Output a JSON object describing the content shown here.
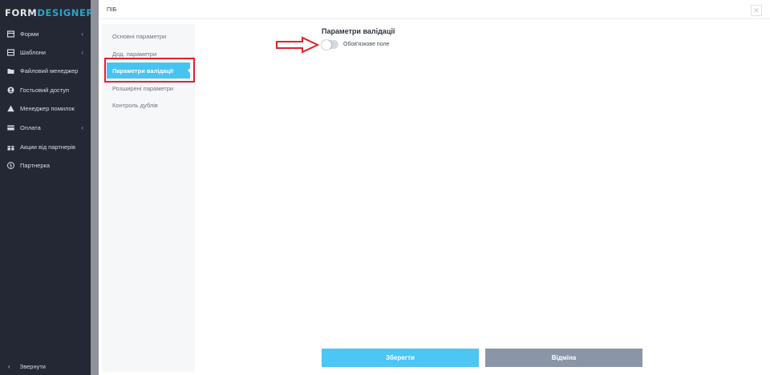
{
  "sidebar": {
    "logo_part1": "FORM",
    "logo_part2": "DESIGNER",
    "items": [
      {
        "label": "Форми",
        "icon": "forms-icon",
        "has_chevron": true
      },
      {
        "label": "Шаблони",
        "icon": "templates-icon",
        "has_chevron": true
      },
      {
        "label": "Файловий менеджер",
        "icon": "folder-icon",
        "has_chevron": false
      },
      {
        "label": "Гостьовий доступ",
        "icon": "user-circle-icon",
        "has_chevron": false
      },
      {
        "label": "Менеджер помилок",
        "icon": "warning-icon",
        "has_chevron": false
      },
      {
        "label": "Оплата",
        "icon": "credit-card-icon",
        "has_chevron": true
      },
      {
        "label": "Акции від партнерів",
        "icon": "gift-icon",
        "has_chevron": false
      },
      {
        "label": "Партнерка",
        "icon": "dollar-icon",
        "has_chevron": false
      }
    ],
    "collapse_label": "Звернути"
  },
  "modal": {
    "title": "ПІБ",
    "tabs": [
      {
        "label": "Основні параметри"
      },
      {
        "label": "Дод. параметри"
      },
      {
        "label": "Параметри валідації"
      },
      {
        "label": "Розширені параметри"
      },
      {
        "label": "Контроль дублів"
      }
    ],
    "active_tab_index": 2,
    "section_title": "Параметри валідації",
    "required_toggle": {
      "label": "Обов'язкове поле",
      "checked": false
    },
    "save_label": "Зберегти",
    "cancel_label": "Відміна"
  },
  "colors": {
    "sidebar_bg": "#232834",
    "accent": "#47c3f2",
    "cancel": "#8a95a7",
    "annotation": "#e2222b"
  }
}
